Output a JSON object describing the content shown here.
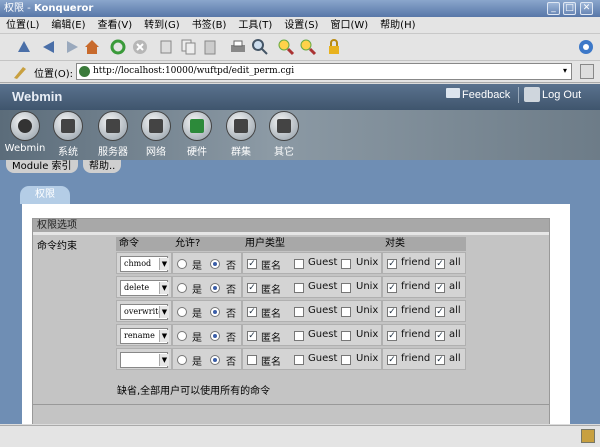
{
  "window": {
    "title": "权限 - ",
    "app_name": "Konqueror",
    "btn_min": "_",
    "btn_max": "□",
    "btn_close": "✕"
  },
  "menu": [
    "位置(L)",
    "编辑(E)",
    "查看(V)",
    "转到(G)",
    "书签(B)",
    "工具(T)",
    "设置(S)",
    "窗口(W)",
    "帮助(H)"
  ],
  "location": {
    "label": "位置(O):",
    "url": "http://localhost:10000/wuftpd/edit_perm.cgi"
  },
  "webmin": {
    "logo": "Webmin",
    "feedback": "Feedback",
    "logout": "Log Out",
    "categories": [
      "Webmin",
      "系统",
      "服务器",
      "网络",
      "硬件",
      "群集",
      "其它"
    ],
    "module_index": "Module 索引",
    "help": "帮助.."
  },
  "page": {
    "tab": "权限",
    "section_title": "权限选项",
    "field_label": "命令约束",
    "headers": {
      "command": "命令",
      "allow": "允许?",
      "user_type": "用户类型",
      "class": "对类"
    },
    "yes": "是",
    "no": "否",
    "anon": "匿名",
    "guest": "Guest",
    "unix": "Unix",
    "friend": "friend",
    "all": "all",
    "rows": [
      {
        "cmd": "chmod",
        "allow": "no",
        "anon": true,
        "guest": false,
        "unix": false,
        "friend": true,
        "all": true
      },
      {
        "cmd": "delete",
        "allow": "no",
        "anon": true,
        "guest": false,
        "unix": false,
        "friend": true,
        "all": true
      },
      {
        "cmd": "overwrite",
        "allow": "no",
        "anon": true,
        "guest": false,
        "unix": false,
        "friend": true,
        "all": true
      },
      {
        "cmd": "rename",
        "allow": "no",
        "anon": true,
        "guest": false,
        "unix": false,
        "friend": true,
        "all": true
      },
      {
        "cmd": "",
        "allow": "no",
        "anon": false,
        "guest": false,
        "unix": false,
        "friend": true,
        "all": true
      }
    ],
    "note": "缺省,全部用户可以使用所有的命令"
  }
}
